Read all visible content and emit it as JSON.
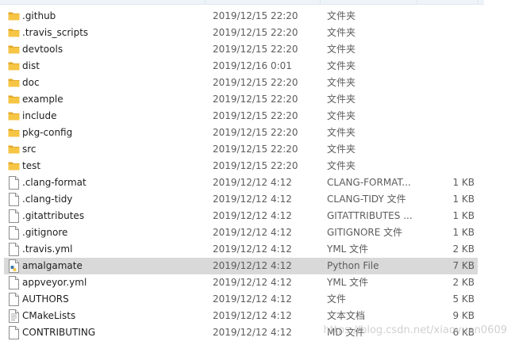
{
  "files": [
    {
      "name": ".github",
      "date": "2019/12/15 22:20",
      "type": "文件夹",
      "size": "",
      "icon": "folder-icon"
    },
    {
      "name": ".travis_scripts",
      "date": "2019/12/15 22:20",
      "type": "文件夹",
      "size": "",
      "icon": "folder-icon"
    },
    {
      "name": "devtools",
      "date": "2019/12/15 22:20",
      "type": "文件夹",
      "size": "",
      "icon": "folder-icon"
    },
    {
      "name": "dist",
      "date": "2019/12/16 0:01",
      "type": "文件夹",
      "size": "",
      "icon": "folder-icon"
    },
    {
      "name": "doc",
      "date": "2019/12/15 22:20",
      "type": "文件夹",
      "size": "",
      "icon": "folder-icon"
    },
    {
      "name": "example",
      "date": "2019/12/15 22:20",
      "type": "文件夹",
      "size": "",
      "icon": "folder-icon"
    },
    {
      "name": "include",
      "date": "2019/12/15 22:20",
      "type": "文件夹",
      "size": "",
      "icon": "folder-icon"
    },
    {
      "name": "pkg-config",
      "date": "2019/12/15 22:20",
      "type": "文件夹",
      "size": "",
      "icon": "folder-icon"
    },
    {
      "name": "src",
      "date": "2019/12/15 22:20",
      "type": "文件夹",
      "size": "",
      "icon": "folder-icon"
    },
    {
      "name": "test",
      "date": "2019/12/15 22:20",
      "type": "文件夹",
      "size": "",
      "icon": "folder-icon"
    },
    {
      "name": ".clang-format",
      "date": "2019/12/12 4:12",
      "type": "CLANG-FORMAT...",
      "size": "1 KB",
      "icon": "file-icon"
    },
    {
      "name": ".clang-tidy",
      "date": "2019/12/12 4:12",
      "type": "CLANG-TIDY 文件",
      "size": "1 KB",
      "icon": "file-icon"
    },
    {
      "name": ".gitattributes",
      "date": "2019/12/12 4:12",
      "type": "GITATTRIBUTES ...",
      "size": "1 KB",
      "icon": "file-icon"
    },
    {
      "name": ".gitignore",
      "date": "2019/12/12 4:12",
      "type": "GITIGNORE 文件",
      "size": "1 KB",
      "icon": "file-icon"
    },
    {
      "name": ".travis.yml",
      "date": "2019/12/12 4:12",
      "type": "YML 文件",
      "size": "2 KB",
      "icon": "file-icon"
    },
    {
      "name": "amalgamate",
      "date": "2019/12/12 4:12",
      "type": "Python File",
      "size": "7 KB",
      "icon": "python-file-icon",
      "selected": true
    },
    {
      "name": "appveyor.yml",
      "date": "2019/12/12 4:12",
      "type": "YML 文件",
      "size": "2 KB",
      "icon": "file-icon"
    },
    {
      "name": "AUTHORS",
      "date": "2019/12/12 4:12",
      "type": "文件",
      "size": "5 KB",
      "icon": "file-icon"
    },
    {
      "name": "CMakeLists",
      "date": "2019/12/12 4:12",
      "type": "文本文档",
      "size": "9 KB",
      "icon": "text-document-icon"
    },
    {
      "name": "CONTRIBUTING",
      "date": "2019/12/12 4:12",
      "type": "MD 文件",
      "size": "6 KB",
      "icon": "file-icon"
    }
  ],
  "watermark": "https://blog.csdn.net/xiaoyuan0609",
  "colors": {
    "folder": "#f6c544",
    "folder_dark": "#e3a92a",
    "selected_row": "#d9d9d9",
    "python_blue": "#3b77a8",
    "python_yellow": "#f2c94c"
  }
}
